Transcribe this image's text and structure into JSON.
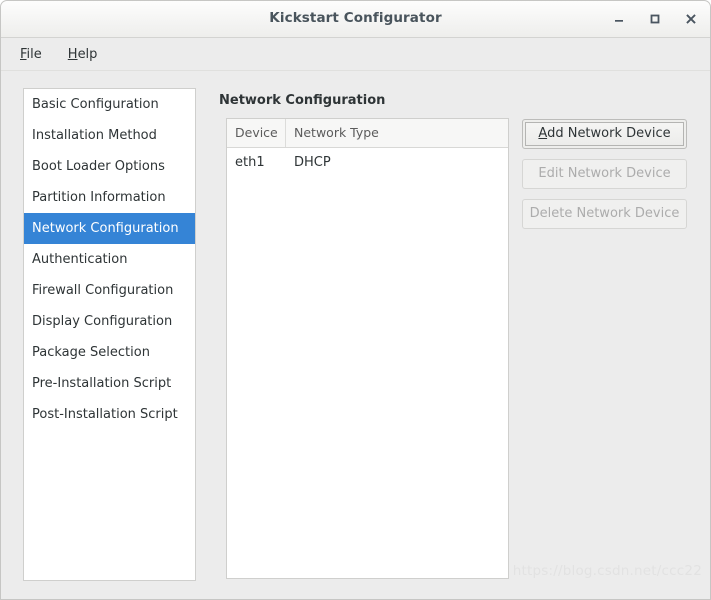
{
  "window": {
    "title": "Kickstart Configurator",
    "controls": {
      "minimize": "minimize-icon",
      "maximize": "maximize-icon",
      "close": "close-icon"
    }
  },
  "menubar": {
    "items": [
      {
        "label": "File",
        "mnemonic": "F"
      },
      {
        "label": "Help",
        "mnemonic": "H"
      }
    ]
  },
  "sidebar": {
    "selected_index": 4,
    "items": [
      {
        "label": "Basic Configuration"
      },
      {
        "label": "Installation Method"
      },
      {
        "label": "Boot Loader Options"
      },
      {
        "label": "Partition Information"
      },
      {
        "label": "Network Configuration"
      },
      {
        "label": "Authentication"
      },
      {
        "label": "Firewall Configuration"
      },
      {
        "label": "Display Configuration"
      },
      {
        "label": "Package Selection"
      },
      {
        "label": "Pre-Installation Script"
      },
      {
        "label": "Post-Installation Script"
      }
    ]
  },
  "main": {
    "title": "Network Configuration",
    "table": {
      "columns": [
        "Device",
        "Network Type"
      ],
      "rows": [
        {
          "device": "eth1",
          "network_type": "DHCP"
        }
      ]
    },
    "buttons": [
      {
        "label": "Add Network Device",
        "mnemonic": "A",
        "enabled": true,
        "focused": true
      },
      {
        "label": "Edit Network Device",
        "enabled": false,
        "focused": false
      },
      {
        "label": "Delete Network Device",
        "enabled": false,
        "focused": false
      }
    ]
  },
  "watermark": {
    "text": "https://blog.csdn.net/ccc22"
  },
  "colors": {
    "selection": "#3584d6",
    "window_bg": "#ececec",
    "text": "#2e3436",
    "title_text": "#49545c",
    "disabled_text": "#acacac"
  }
}
